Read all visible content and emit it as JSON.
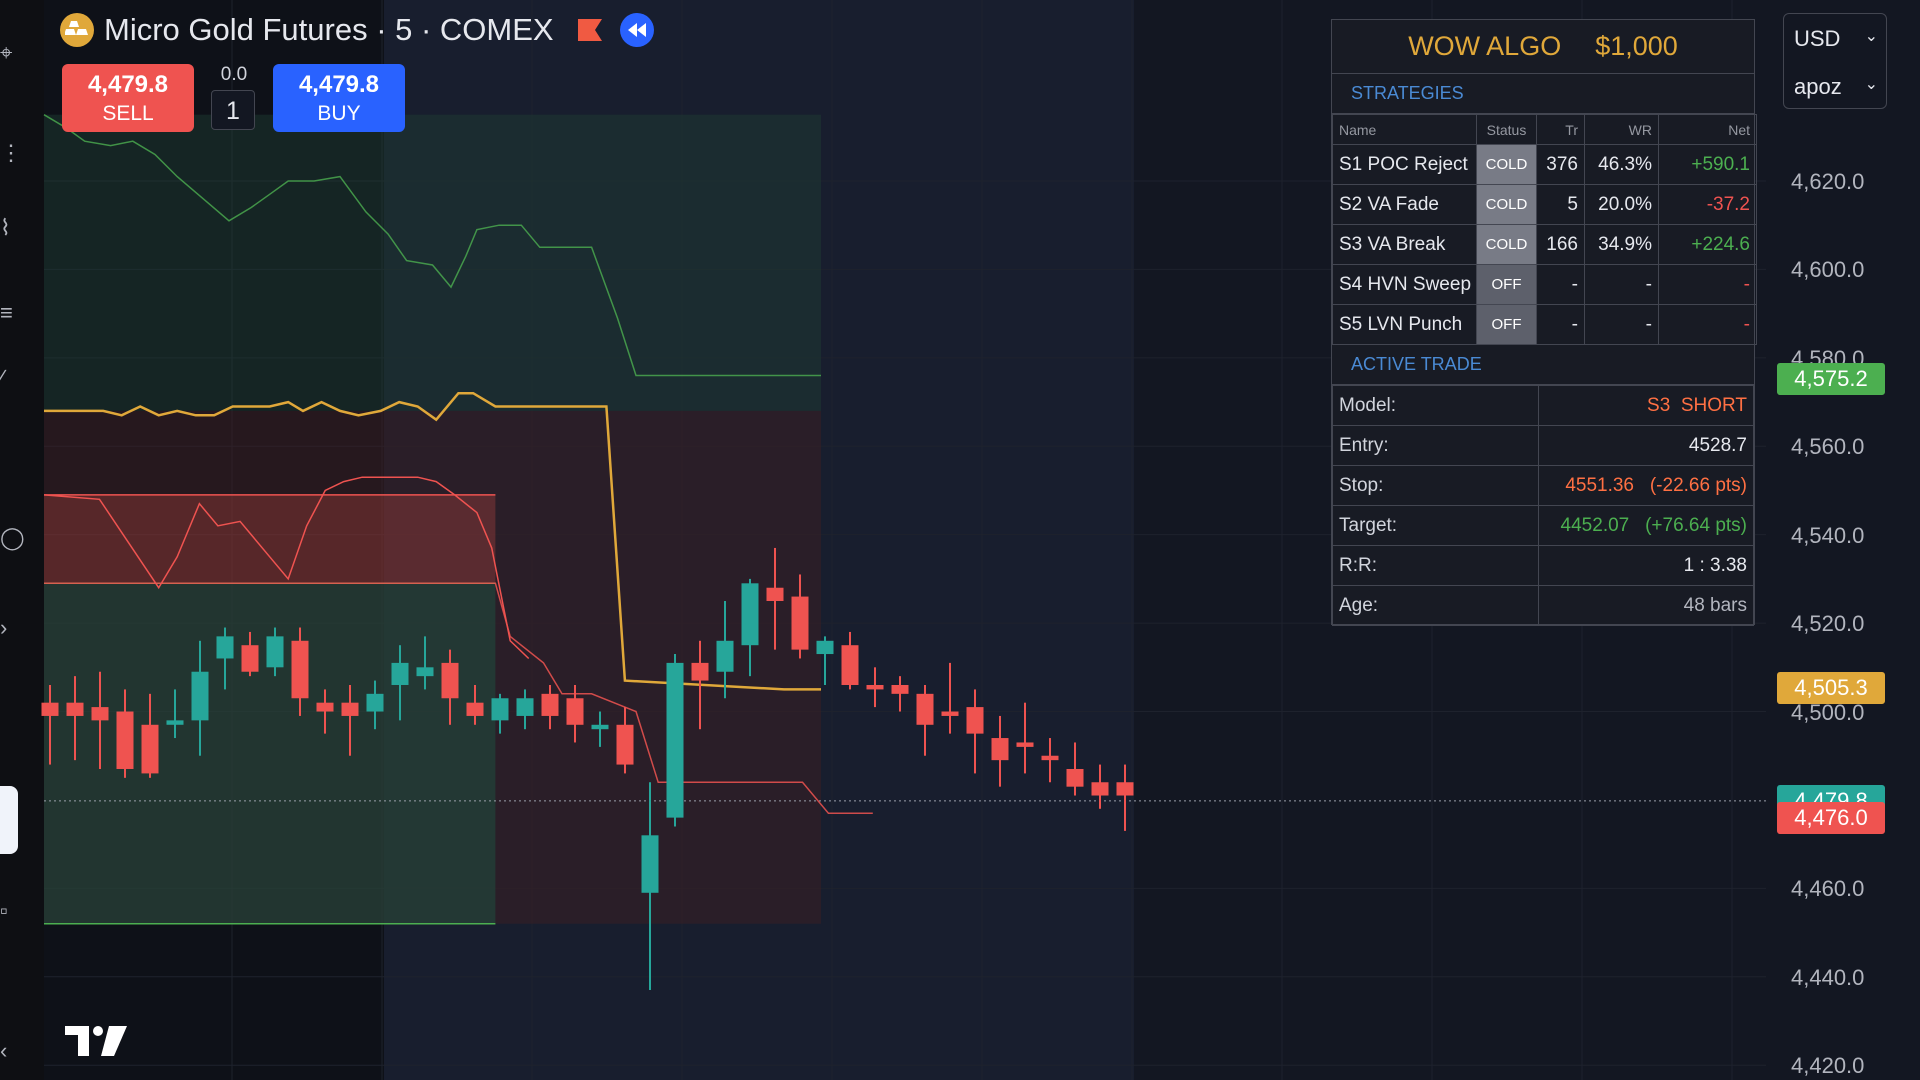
{
  "header": {
    "symbol_title": "Micro Gold Futures · 5 · COMEX",
    "logo_icon": "gold-bars-icon",
    "flag_icon": "flag-icon",
    "rewind_icon": "rewind-icon"
  },
  "trade_widget": {
    "sell_price": "4,479.8",
    "sell_label": "SELL",
    "buy_price": "4,479.8",
    "buy_label": "BUY",
    "spread": "0.0",
    "quantity": "1"
  },
  "algo_panel": {
    "title": "WOW ALGO",
    "capital": "$1,000",
    "strategies_title": "STRATEGIES",
    "columns": [
      "Name",
      "Status",
      "Tr",
      "WR",
      "Net"
    ],
    "strategies": [
      {
        "name": "S1 POC Reject",
        "status": "COLD",
        "tr": "376",
        "wr": "46.3%",
        "net": "+590.1"
      },
      {
        "name": "S2 VA Fade",
        "status": "COLD",
        "tr": "5",
        "wr": "20.0%",
        "net": "-37.2"
      },
      {
        "name": "S3 VA Break",
        "status": "COLD",
        "tr": "166",
        "wr": "34.9%",
        "net": "+224.6"
      },
      {
        "name": "S4 HVN Sweep",
        "status": "OFF",
        "tr": "-",
        "wr": "-",
        "net": "-"
      },
      {
        "name": "S5 LVN Punch",
        "status": "OFF",
        "tr": "-",
        "wr": "-",
        "net": "-"
      }
    ],
    "active_trade_title": "ACTIVE TRADE",
    "active_trade": {
      "model_label": "Model:",
      "model_value": "S3  SHORT",
      "entry_label": "Entry:",
      "entry_value": "4528.7",
      "stop_label": "Stop:",
      "stop_value": "4551.36",
      "stop_pts": "(-22.66 pts)",
      "target_label": "Target:",
      "target_value": "4452.07",
      "target_pts": "(+76.64 pts)",
      "rr_label": "R:R:",
      "rr_value": "1 : 3.38",
      "age_label": "Age:",
      "age_value": "48 bars"
    }
  },
  "currency": {
    "currency_label": "USD",
    "user_label": "apoz",
    "chevron_icon": "chevron-down-icon"
  },
  "price_axis": {
    "ticks": [
      {
        "value": 4620,
        "label": "4,620.0"
      },
      {
        "value": 4600,
        "label": "4,600.0"
      },
      {
        "value": 4580,
        "label": "4,580.0"
      },
      {
        "value": 4560,
        "label": "4,560.0"
      },
      {
        "value": 4540,
        "label": "4,540.0"
      },
      {
        "value": 4520,
        "label": "4,520.0"
      },
      {
        "value": 4500,
        "label": "4,500.0"
      },
      {
        "value": 4460,
        "label": "4,460.0"
      },
      {
        "value": 4440,
        "label": "4,440.0"
      },
      {
        "value": 4420,
        "label": "4,420.0"
      }
    ],
    "badges": [
      {
        "value": 4575.2,
        "label": "4,575.2",
        "color": "#4caf50"
      },
      {
        "value": 4505.3,
        "label": "4,505.3",
        "color": "#e0a83a"
      },
      {
        "value": 4479.8,
        "label": "4,479.8",
        "color": "#26a69a"
      },
      {
        "value": 4476.0,
        "label": "4,476.0",
        "color": "#ef5350"
      }
    ]
  },
  "colors": {
    "up": "#26a69a",
    "down": "#ef5350",
    "accent": "#2962ff",
    "gold": "#e0a83a",
    "background": "#131722"
  },
  "chart_data": {
    "type": "candlestick",
    "title": "Micro Gold Futures · 5 · COMEX",
    "ylim": [
      4417,
      4658
    ],
    "last_price": 4479.8,
    "candles": [
      {
        "o": 4502,
        "h": 4506,
        "l": 4488,
        "c": 4499
      },
      {
        "o": 4502,
        "h": 4508,
        "l": 4489,
        "c": 4499
      },
      {
        "o": 4501,
        "h": 4509,
        "l": 4487,
        "c": 4498
      },
      {
        "o": 4500,
        "h": 4505,
        "l": 4485,
        "c": 4487
      },
      {
        "o": 4497,
        "h": 4504,
        "l": 4485,
        "c": 4486
      },
      {
        "o": 4497,
        "h": 4505,
        "l": 4494,
        "c": 4498
      },
      {
        "o": 4498,
        "h": 4516,
        "l": 4490,
        "c": 4509
      },
      {
        "o": 4512,
        "h": 4519,
        "l": 4505,
        "c": 4517
      },
      {
        "o": 4515,
        "h": 4518,
        "l": 4508,
        "c": 4509
      },
      {
        "o": 4510,
        "h": 4519,
        "l": 4508,
        "c": 4517
      },
      {
        "o": 4516,
        "h": 4519,
        "l": 4499,
        "c": 4503
      },
      {
        "o": 4502,
        "h": 4505,
        "l": 4495,
        "c": 4500
      },
      {
        "o": 4502,
        "h": 4506,
        "l": 4490,
        "c": 4499
      },
      {
        "o": 4500,
        "h": 4507,
        "l": 4496,
        "c": 4504
      },
      {
        "o": 4506,
        "h": 4515,
        "l": 4498,
        "c": 4511
      },
      {
        "o": 4508,
        "h": 4517,
        "l": 4505,
        "c": 4510
      },
      {
        "o": 4511,
        "h": 4514,
        "l": 4497,
        "c": 4503
      },
      {
        "o": 4502,
        "h": 4506,
        "l": 4497,
        "c": 4499
      },
      {
        "o": 4498,
        "h": 4504,
        "l": 4495,
        "c": 4503
      },
      {
        "o": 4499,
        "h": 4505,
        "l": 4496,
        "c": 4503
      },
      {
        "o": 4504,
        "h": 4506,
        "l": 4496,
        "c": 4499
      },
      {
        "o": 4503,
        "h": 4506,
        "l": 4493,
        "c": 4497
      },
      {
        "o": 4496,
        "h": 4500,
        "l": 4492,
        "c": 4497
      },
      {
        "o": 4497,
        "h": 4501,
        "l": 4486,
        "c": 4488
      },
      {
        "o": 4459,
        "h": 4484,
        "l": 4437,
        "c": 4472
      },
      {
        "o": 4476,
        "h": 4513,
        "l": 4474,
        "c": 4511
      },
      {
        "o": 4511,
        "h": 4516,
        "l": 4496,
        "c": 4507
      },
      {
        "o": 4509,
        "h": 4525,
        "l": 4503,
        "c": 4516
      },
      {
        "o": 4515,
        "h": 4530,
        "l": 4508,
        "c": 4529
      },
      {
        "o": 4528,
        "h": 4537,
        "l": 4514,
        "c": 4525
      },
      {
        "o": 4526,
        "h": 4531,
        "l": 4512,
        "c": 4514
      },
      {
        "o": 4513,
        "h": 4517,
        "l": 4506,
        "c": 4516
      },
      {
        "o": 4515,
        "h": 4518,
        "l": 4505,
        "c": 4506
      },
      {
        "o": 4506,
        "h": 4510,
        "l": 4501,
        "c": 4505
      },
      {
        "o": 4506,
        "h": 4508,
        "l": 4500,
        "c": 4504
      },
      {
        "o": 4504,
        "h": 4506,
        "l": 4490,
        "c": 4497
      },
      {
        "o": 4500,
        "h": 4511,
        "l": 4495,
        "c": 4499
      },
      {
        "o": 4501,
        "h": 4505,
        "l": 4486,
        "c": 4495
      },
      {
        "o": 4494,
        "h": 4499,
        "l": 4483,
        "c": 4489
      },
      {
        "o": 4493,
        "h": 4502,
        "l": 4486,
        "c": 4492
      },
      {
        "o": 4490,
        "h": 4494,
        "l": 4484,
        "c": 4489
      },
      {
        "o": 4487,
        "h": 4493,
        "l": 4481,
        "c": 4483
      },
      {
        "o": 4484,
        "h": 4488,
        "l": 4478,
        "c": 4481
      },
      {
        "o": 4484,
        "h": 4488,
        "l": 4473,
        "c": 4481
      }
    ],
    "poc_line": [
      [
        0,
        4568
      ],
      [
        16,
        4568
      ],
      [
        21,
        4567
      ],
      [
        26,
        4569
      ],
      [
        31,
        4567
      ],
      [
        36,
        4568
      ],
      [
        41,
        4567
      ],
      [
        46,
        4567
      ],
      [
        51,
        4569
      ],
      [
        56,
        4569
      ],
      [
        61,
        4569
      ],
      [
        66,
        4570
      ],
      [
        70,
        4568
      ],
      [
        75,
        4570
      ],
      [
        80,
        4568
      ],
      [
        85,
        4567
      ],
      [
        91,
        4568
      ],
      [
        96,
        4570
      ],
      [
        101,
        4569
      ],
      [
        106,
        4566
      ],
      [
        112,
        4572
      ],
      [
        116,
        4572
      ],
      [
        122,
        4569
      ],
      [
        152,
        4569
      ],
      [
        157,
        4507
      ],
      [
        200,
        4505
      ],
      [
        210,
        4505
      ]
    ],
    "vah_line": [
      [
        0,
        4635
      ],
      [
        6,
        4632
      ],
      [
        11,
        4629
      ],
      [
        18,
        4628
      ],
      [
        24,
        4629
      ],
      [
        30,
        4626
      ],
      [
        36,
        4621
      ],
      [
        43,
        4616
      ],
      [
        50,
        4611
      ],
      [
        56,
        4614
      ],
      [
        61,
        4617
      ],
      [
        66,
        4620
      ],
      [
        73,
        4620
      ],
      [
        80,
        4621
      ],
      [
        87,
        4613
      ],
      [
        93,
        4608
      ],
      [
        98,
        4602
      ],
      [
        105,
        4601
      ],
      [
        110,
        4596
      ],
      [
        114,
        4603
      ],
      [
        117,
        4609
      ],
      [
        123,
        4610
      ],
      [
        129,
        4610
      ],
      [
        134,
        4605
      ],
      [
        148,
        4605
      ],
      [
        155,
        4589
      ],
      [
        160,
        4576
      ],
      [
        210,
        4576
      ]
    ],
    "val_line": [
      [
        0,
        4529
      ],
      [
        122,
        4529
      ],
      [
        126,
        4517
      ],
      [
        135,
        4511
      ],
      [
        140,
        4504
      ],
      [
        148,
        4504
      ],
      [
        160,
        4500
      ],
      [
        166,
        4484
      ],
      [
        205,
        4484
      ],
      [
        212,
        4477
      ],
      [
        224,
        4477
      ]
    ],
    "va_low_line": [
      [
        0,
        4452
      ],
      [
        122,
        4452
      ]
    ],
    "inner_line": [
      [
        0,
        4549
      ],
      [
        15,
        4548
      ],
      [
        31,
        4528
      ],
      [
        36,
        4535
      ],
      [
        42,
        4547
      ],
      [
        47,
        4542
      ],
      [
        53,
        4543
      ],
      [
        61,
        4535
      ],
      [
        66,
        4530
      ],
      [
        71,
        4542
      ],
      [
        76,
        4550
      ],
      [
        81,
        4552
      ],
      [
        86,
        4553
      ],
      [
        91,
        4553
      ],
      [
        96,
        4553
      ],
      [
        101,
        4553
      ],
      [
        106,
        4552
      ],
      [
        111,
        4549
      ],
      [
        117,
        4545
      ],
      [
        121,
        4537
      ],
      [
        126,
        4516
      ],
      [
        131,
        4512
      ]
    ]
  }
}
